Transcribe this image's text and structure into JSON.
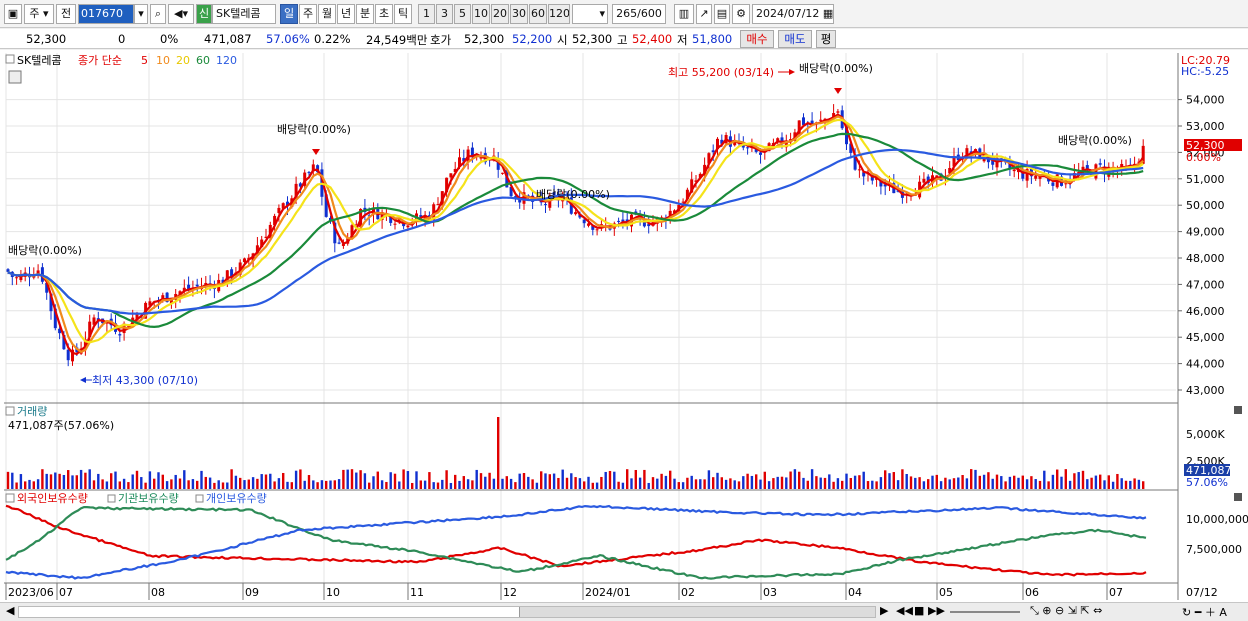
{
  "toolbar": {
    "period": "주",
    "prev": "전",
    "code": "017670",
    "type_badge": "신",
    "stock_name": "SK텔레콤",
    "periods": [
      "일",
      "주",
      "월",
      "년",
      "분",
      "초",
      "틱"
    ],
    "active_period": "일",
    "intervals": [
      "1",
      "3",
      "5",
      "10",
      "20",
      "30",
      "60",
      "120"
    ],
    "count": "265",
    "count_max": "/600",
    "date": "2024/07/12"
  },
  "quote": {
    "price": "52,300",
    "change": "0",
    "change_pct": "0%",
    "volume": "471,087",
    "vol_ratio": "57.06%",
    "turnover_pct": "0.22%",
    "amount": "24,549백만",
    "ask_label": "호가",
    "ask": "52,300",
    "bid": "52,200",
    "open_label": "시",
    "open": "52,300",
    "high_label": "고",
    "high": "52,400",
    "low_label": "저",
    "low": "51,800",
    "buy_label": "매수",
    "sell_label": "매도",
    "eval_label": "평"
  },
  "price_panel": {
    "name": "SK텔레콤",
    "ma_label": "종가 단순",
    "ma_periods": [
      {
        "label": "5",
        "color": "#e00000"
      },
      {
        "label": "10",
        "color": "#f08a1c"
      },
      {
        "label": "20",
        "color": "#f5e31a"
      },
      {
        "label": "60",
        "color": "#1a8a3a"
      },
      {
        "label": "120",
        "color": "#2a5ae0"
      }
    ],
    "lc": "LC:20.79",
    "hc": "HC:-5.25",
    "y_ticks": [
      "54,000",
      "53,000",
      "52,000",
      "51,000",
      "50,000",
      "49,000",
      "48,000",
      "47,000",
      "46,000",
      "45,000",
      "44,000",
      "43,000"
    ],
    "current_price_tag": "52,300",
    "current_pct_tag": "0.00%",
    "annotations": {
      "high": "최고 55,200 (03/14)",
      "low": "최저 43,300 (07/10)",
      "div1": "배당락(0.00%)",
      "div2": "배당락(0.00%)",
      "div3": "배당락(0.00%)",
      "div4": "배당락(0.00%)",
      "div5": "배당락(0.00%)"
    }
  },
  "volume_panel": {
    "title": "거래량",
    "value": "471,087주(57.06%)",
    "y_ticks": [
      "5,000K",
      "2,500K"
    ],
    "tag": "471,087",
    "tag_pct": "57.06%"
  },
  "holdings_panel": {
    "legend": [
      {
        "label": "외국인보유수량",
        "color": "#e00000"
      },
      {
        "label": "기관보유수량",
        "color": "#1a8a5a"
      },
      {
        "label": "개인보유수량",
        "color": "#2a5ae0"
      }
    ],
    "y_ticks": [
      "10,000,000",
      "7,500,000"
    ]
  },
  "x_axis": {
    "labels": [
      "2023/06",
      "07",
      "08",
      "09",
      "10",
      "11",
      "12",
      "2024/01",
      "02",
      "03",
      "04",
      "05",
      "06",
      "07"
    ],
    "end_date": "07/12"
  }
}
